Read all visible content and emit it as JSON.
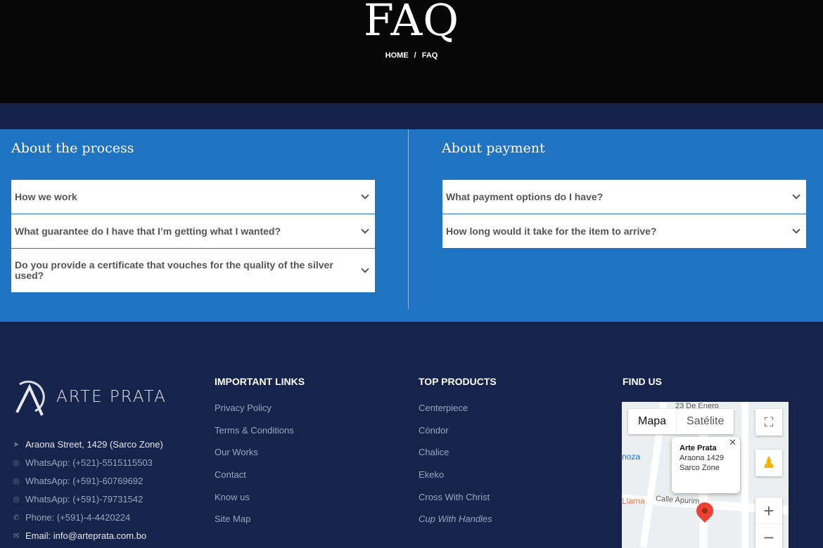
{
  "hero": {
    "title": "FAQ",
    "breadcrumb": [
      "HOME",
      "/",
      "FAQ"
    ]
  },
  "faq": {
    "left": {
      "title": "About the process",
      "items": [
        "How we work",
        "What guarantee do I have that I’m getting what I wanted?",
        "Do you provide a certificate that vouches for the quality of the silver used?"
      ]
    },
    "right": {
      "title": "About payment",
      "items": [
        "What payment options do I have?",
        "How long would it take for the item to arrive?"
      ]
    }
  },
  "footer": {
    "logo_text": "ARTE PRATA",
    "contact": [
      {
        "icon": "location-arrow-icon",
        "text": "Araona Street, 1429 (Sarco Zone)"
      },
      {
        "icon": "whatsapp-icon",
        "text": "WhatsApp: (+521)-5515115503"
      },
      {
        "icon": "whatsapp-icon",
        "text": "WhatsApp: (+591)-60769692"
      },
      {
        "icon": "whatsapp-icon",
        "text": "WhatsApp: (+591)-79731542"
      },
      {
        "icon": "phone-icon",
        "text": "Phone: (+591)-4-4420224"
      },
      {
        "icon": "envelope-icon",
        "text": "Email: info@arteprata.com.bo"
      }
    ],
    "important_links": {
      "title": "IMPORTANT LINKS",
      "items": [
        "Privacy Policy",
        "Terms & Conditions",
        "Our Works",
        "Contact",
        "Know us",
        "Site Map"
      ]
    },
    "top_products": {
      "title": "TOP PRODUCTS",
      "items": [
        "Centerpiece",
        "Cóndor",
        "Chalice",
        "Ekeko",
        "Cross With Christ",
        "Cup With Handles"
      ]
    },
    "find_us": {
      "title": "FIND US"
    },
    "map": {
      "tab_map": "Mapa",
      "tab_satellite": "Satélite",
      "popup_title": "Arte Prata",
      "popup_line1": "Araona 1429",
      "popup_line2": "Sarco Zone",
      "labels": [
        "23 De Enero",
        "noza",
        "Llama",
        "Calle Apurim"
      ]
    }
  },
  "colors": {
    "hero_bg": "#070707",
    "faq_bg": "#1f73c0",
    "footer_bg": "#16234a"
  }
}
